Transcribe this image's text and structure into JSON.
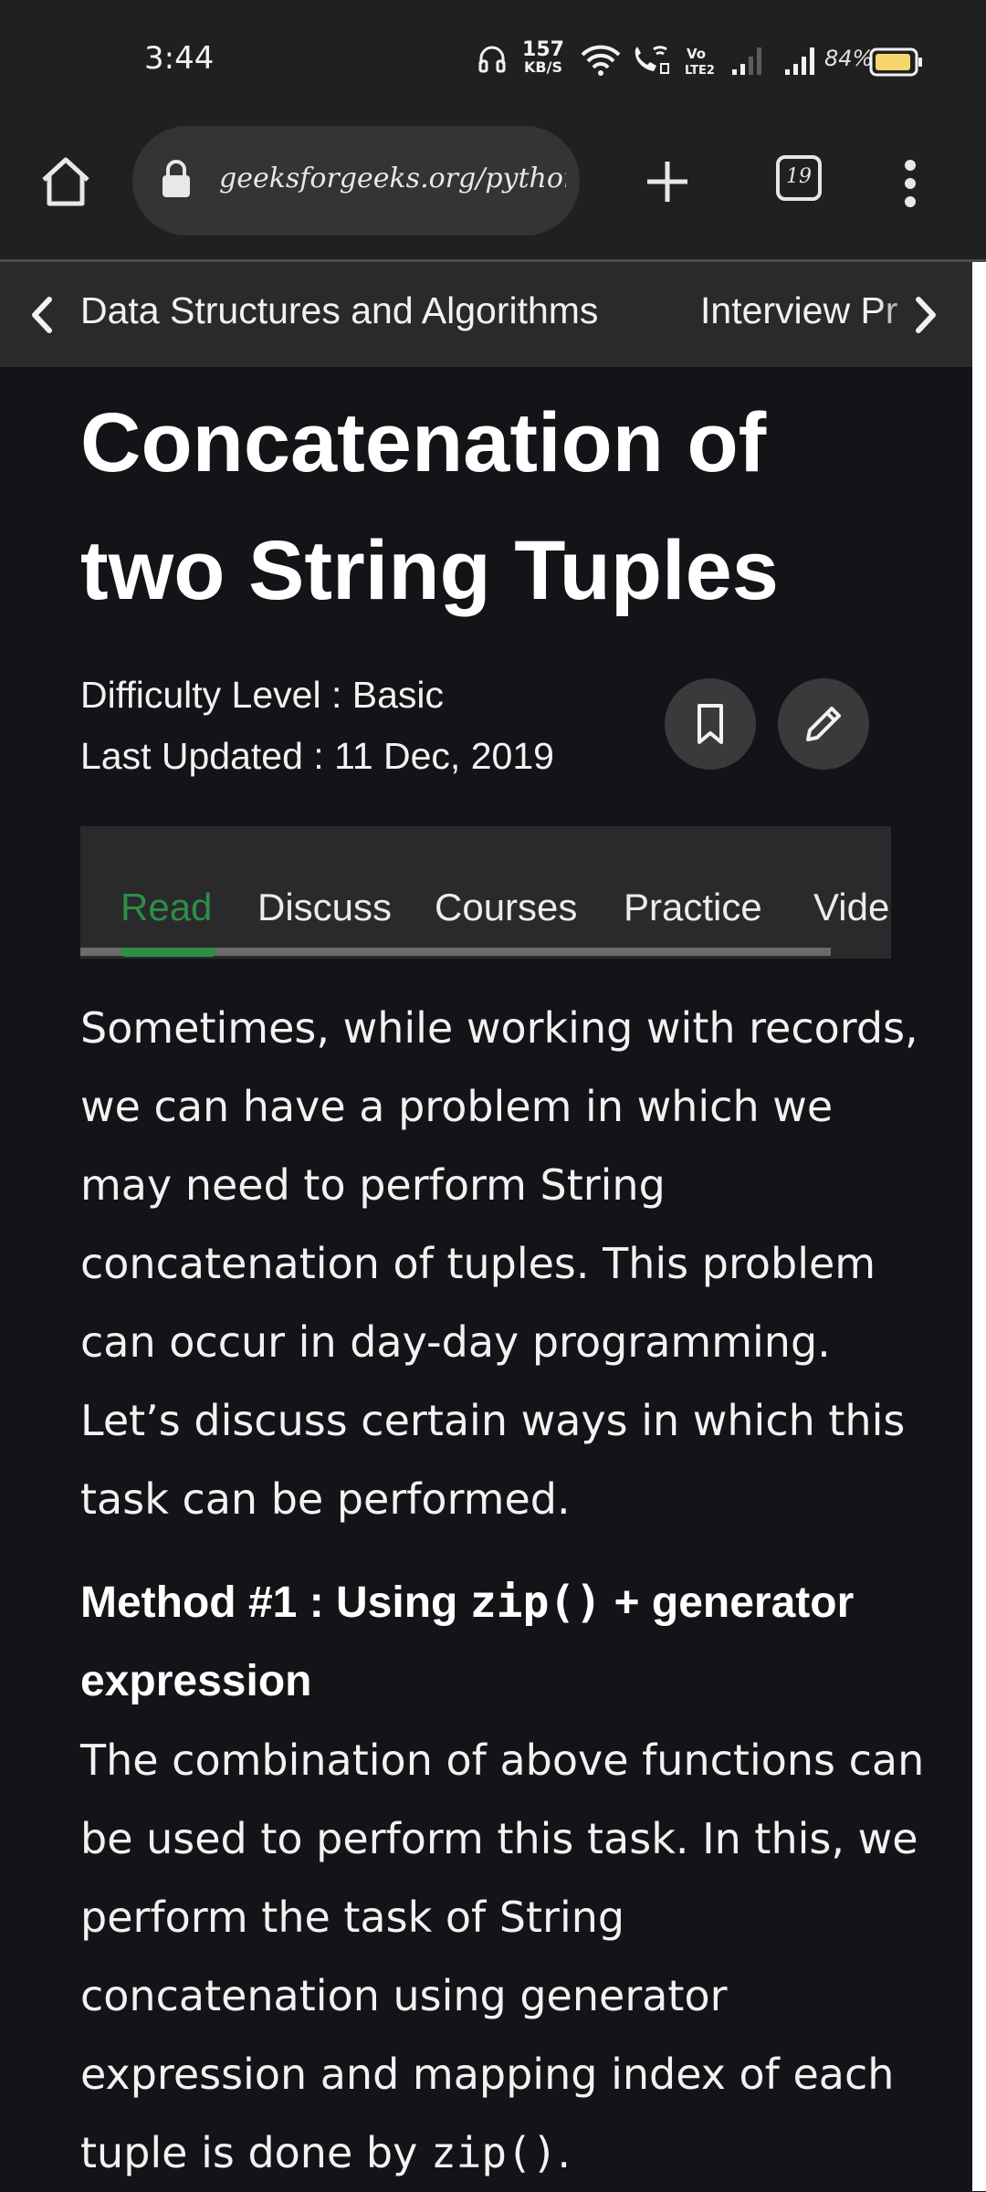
{
  "status_bar": {
    "time": "3:44",
    "net_speed_value": "157",
    "net_speed_unit": "KB/S",
    "battery_percent": "84%"
  },
  "browser": {
    "url": "geeksforgeeks.org/python-c",
    "tab_count": "19"
  },
  "breadcrumbs": [
    "Data Structures and Algorithms",
    "Interview Pr"
  ],
  "article": {
    "title": "Concatenation of two String Tuples",
    "difficulty": "Difficulty Level : Basic",
    "last_updated": "Last Updated : 11 Dec, 2019",
    "tabs": [
      "Read",
      "Discuss",
      "Courses",
      "Practice",
      "Vide"
    ],
    "active_tab": "Read",
    "intro": "Sometimes, while working with records, we can have a problem in which we may need to perform String concatenation of tuples. This problem can occur in day-day programming. Let’s discuss certain ways in which this task can be performed.",
    "method_heading_prefix": "Method #1 : Using ",
    "method_heading_code": "zip()",
    "method_heading_suffix": " + generator expression",
    "method_body_text": "The combination of above functions can be used to perform this task. In this, we perform the task of String concatenation using generator expression and mapping index of each tuple is done by ",
    "method_body_code": "zip()",
    "method_body_end": "."
  },
  "colors": {
    "accent_green": "#2f8d46",
    "page_bg": "#131417",
    "chrome_bg": "#202020"
  }
}
